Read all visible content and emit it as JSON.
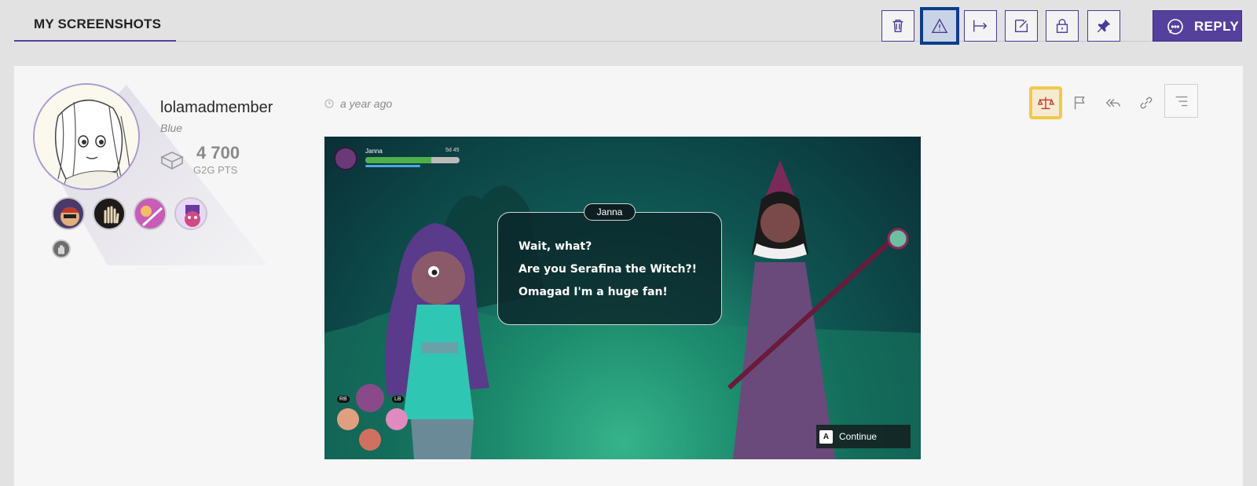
{
  "header": {
    "section_title": "MY SCREENSHOTS",
    "reply_label": "REPLY"
  },
  "toolbar": {
    "icons": [
      "trash-icon",
      "warning-icon",
      "move-icon",
      "edit-icon",
      "lock-icon",
      "pin-icon",
      "chat-icon"
    ],
    "focused": "warning-icon"
  },
  "post": {
    "username": "lolamadmember",
    "rank": "Blue",
    "points": "4 700",
    "points_label": "G2G PTS",
    "timestamp": "a year ago",
    "actions": [
      "scales-icon",
      "flag-icon",
      "reply-all-icon",
      "link-icon",
      "menu-icon"
    ],
    "focused_action": "scales-icon"
  },
  "screenshot": {
    "hud_name": "Janna",
    "hud_count": "5d 45",
    "hud_health": 0.7,
    "speaker": "Janna",
    "dialogue": [
      "Wait, what?",
      "Are you Serafina the Witch?!",
      "Omagad I'm a huge fan!"
    ],
    "continue_key": "A",
    "continue_label": "Continue",
    "rb": "RB",
    "lb": "LB"
  },
  "colors": {
    "accent": "#55419c",
    "focus_blue": "#0a3e8a",
    "focus_yellow": "#f0c94a"
  }
}
